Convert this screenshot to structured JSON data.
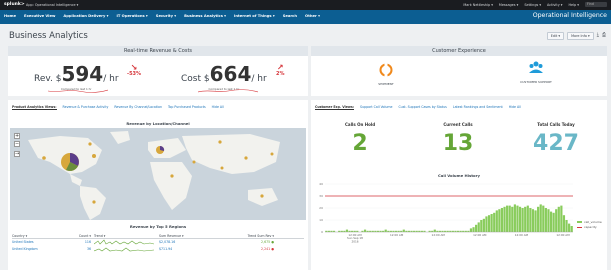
{
  "topbar": {
    "logo": "splunk>",
    "app": "App: Operational Intelligence ▾",
    "menu": [
      "Mark Nettleship ▾",
      "Messages ▾",
      "Settings ▾",
      "Activity ▾",
      "Help ▾"
    ],
    "find": "Find"
  },
  "appbar": {
    "nav": [
      "Home",
      "Executive View",
      "Application Delivery ▾",
      "IT Operations ▾",
      "Security ▾",
      "Business Analytics ▾",
      "Internet of Things ▾",
      "Search",
      "Other ▾"
    ],
    "title": "Operational Intelligence"
  },
  "dashboard": {
    "title": "Business Analytics",
    "edit": "Edit ▾",
    "more": "More Info ▾",
    "export_icon": "download-icon",
    "print_icon": "print-icon"
  },
  "revenue": {
    "title": "Real-time Revenue & Costs",
    "rev_label": "Rev. $",
    "rev_value": "594",
    "rev_unit": "/ hr",
    "rev_sub": "Compared to last 1 hr",
    "rev_delta": "-53%",
    "cost_label": "Cost $",
    "cost_value": "664",
    "cost_unit": "/ hr",
    "cost_sub": "Compared to last 1 hr",
    "cost_delta": "2%",
    "colors": {
      "trend": "#d6363b",
      "spark": "#d6363b"
    }
  },
  "product_tabs": [
    "Product Analytics Views:",
    "Revenue & Purchase Activity",
    "Revenue By Channel/Location",
    "Top Purchased Products",
    "Hide All"
  ],
  "map": {
    "title": "Revenue by Location/Channel",
    "zoom_in": "+",
    "zoom_out": "−"
  },
  "region_table": {
    "title": "Revenue by Top 5 Regions",
    "headers": [
      "Country ▾",
      "Count ▾",
      "Trend ▾",
      "Sum Revenue ▾",
      "Trend Sum Rev ▾"
    ],
    "rows": [
      {
        "country": "United States",
        "count": "116",
        "sum": "$2,078.16",
        "trend": "2,675"
      },
      {
        "country": "United Kingdom",
        "count": "36",
        "sum": "$711.94",
        "trend": "2,241"
      }
    ]
  },
  "customer": {
    "title": "Customer Experience",
    "shipment_label": "SHIPMENT",
    "support_label": "CUSTOMER SUPPORT"
  },
  "cust_tabs": [
    "Customer Exp. Views:",
    "Support Call Volume",
    "Cust. Support Cases by Status",
    "Latest Rankings and Sentiment",
    "Hide All"
  ],
  "calls": {
    "on_hold_title": "Calls On Hold",
    "on_hold_value": "2",
    "current_title": "Current Calls",
    "current_value": "13",
    "total_title": "Total Calls Today",
    "total_value": "427",
    "colors": {
      "on_hold": "#65a637",
      "current": "#65a637",
      "total": "#6ab7c7"
    }
  },
  "chart_data": {
    "type": "bar",
    "title": "Call Volume History",
    "x_ticks": [
      "12:00 AM\nSun Sep 18\n2016",
      "12:00 AM",
      "12:00 AM",
      "12:00 AM",
      "12:00 AM",
      "12:00 AM"
    ],
    "y_ticks": [
      "40",
      "30",
      "20",
      "10",
      "0"
    ],
    "ylim": [
      0,
      40
    ],
    "series": [
      {
        "name": "call_volume",
        "color": "#89cc5c",
        "values": [
          1,
          1,
          1,
          1,
          0,
          1,
          1,
          1,
          2,
          1,
          1,
          1,
          1,
          0,
          1,
          2,
          1,
          1,
          1,
          1,
          1,
          1,
          1,
          2,
          1,
          1,
          1,
          1,
          1,
          1,
          2,
          1,
          1,
          1,
          1,
          1,
          1,
          1,
          1,
          0,
          1,
          1,
          2,
          1,
          1,
          1,
          1,
          1,
          1,
          1,
          1,
          1,
          1,
          1,
          1,
          1,
          3,
          4,
          6,
          8,
          10,
          11,
          13,
          14,
          15,
          16,
          18,
          19,
          20,
          21,
          22,
          22,
          21,
          23,
          22,
          21,
          20,
          21,
          22,
          20,
          19,
          18,
          21,
          23,
          22,
          20,
          19,
          17,
          16,
          19,
          21,
          22,
          14,
          10,
          7,
          5
        ]
      },
      {
        "name": "capacity",
        "color": "#d6363b",
        "values": []
      }
    ],
    "capacity": 30
  }
}
